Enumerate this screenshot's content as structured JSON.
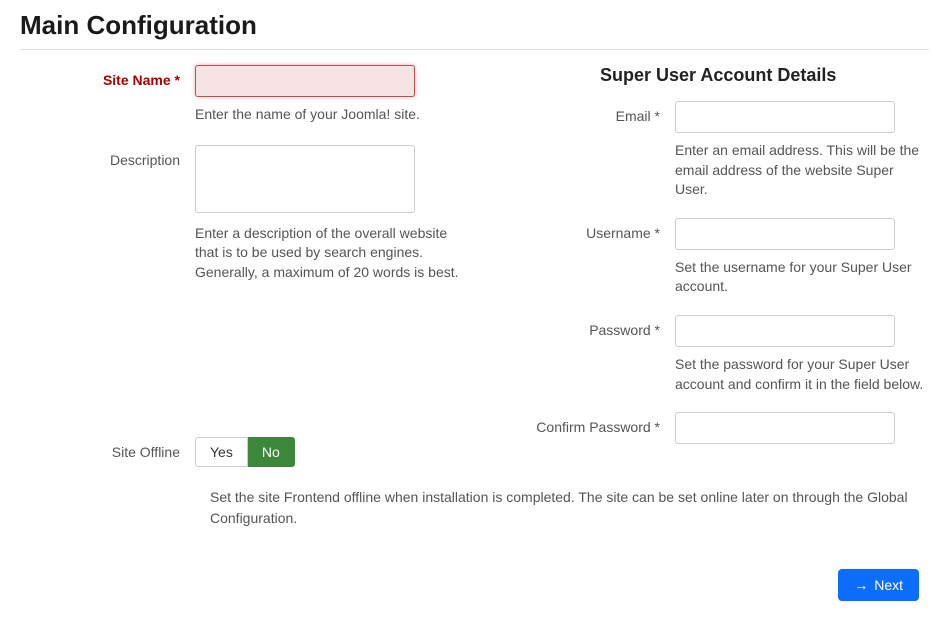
{
  "page": {
    "title": "Main Configuration"
  },
  "form": {
    "left": {
      "site_name": {
        "label": "Site Name *",
        "value": "",
        "help": "Enter the name of your Joomla! site."
      },
      "description": {
        "label": "Description",
        "value": "",
        "help": "Enter a description of the overall website that is to be used by search engines. Generally, a maximum of 20 words is best."
      },
      "site_offline": {
        "label": "Site Offline",
        "yes": "Yes",
        "no": "No",
        "active": "no",
        "help": "Set the site Frontend offline when installation is completed. The site can be set online later on through the Global Configuration."
      }
    },
    "right": {
      "section_title": "Super User Account Details",
      "email": {
        "label": "Email *",
        "value": "",
        "help": "Enter an email address. This will be the email address of the website Super User."
      },
      "username": {
        "label": "Username *",
        "value": "",
        "help": "Set the username for your Super User account."
      },
      "password": {
        "label": "Password *",
        "value": "",
        "help": "Set the password for your Super User account and confirm it in the field below."
      },
      "confirm_password": {
        "label": "Confirm Password *",
        "value": ""
      }
    }
  },
  "buttons": {
    "next": "Next"
  }
}
